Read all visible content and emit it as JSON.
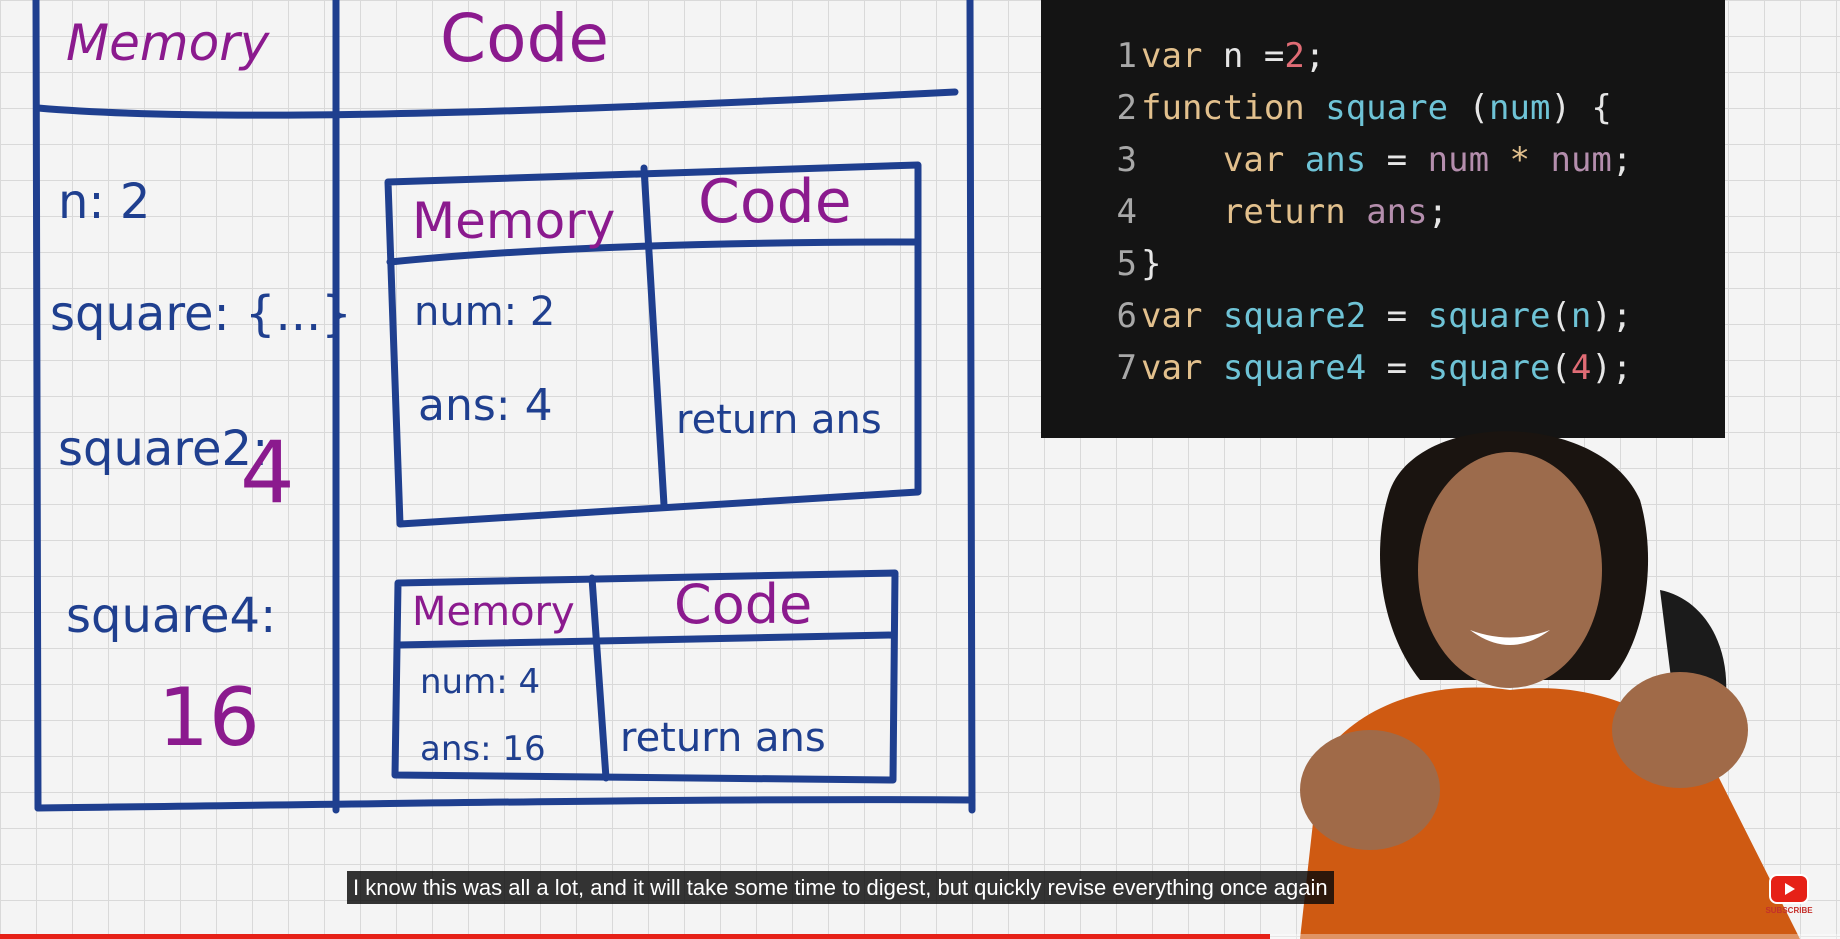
{
  "whiteboard": {
    "outer_headers": {
      "memory": "Memory",
      "code": "Code"
    },
    "global_memory": {
      "n": "n: 2",
      "square": "square: {...}",
      "square2_label": "square2:",
      "square2_value": "4",
      "square4_label": "square4:",
      "square4_value": "16"
    },
    "ctx1": {
      "memory_header": "Memory",
      "code_header": "Code",
      "num": "num: 2",
      "ans": "ans: 4",
      "code": "return ans"
    },
    "ctx2": {
      "memory_header": "Memory",
      "code_header": "Code",
      "num": "num: 4",
      "ans": "ans: 16",
      "code": "return ans"
    }
  },
  "code": {
    "lines": [
      {
        "n": "1",
        "tokens": [
          [
            "kw",
            "var "
          ],
          [
            "txt",
            "n ="
          ],
          [
            "num",
            "2"
          ],
          [
            "txt",
            ";"
          ]
        ]
      },
      {
        "n": "2",
        "tokens": [
          [
            "kw",
            "function "
          ],
          [
            "fn",
            "square "
          ],
          [
            "txt",
            "("
          ],
          [
            "fn",
            "num"
          ],
          [
            "txt",
            ") {"
          ]
        ]
      },
      {
        "n": "3",
        "tokens": [
          [
            "txt",
            "    "
          ],
          [
            "kw",
            "var "
          ],
          [
            "fn",
            "ans "
          ],
          [
            "txt",
            "= "
          ],
          [
            "var",
            "num "
          ],
          [
            "kw",
            "* "
          ],
          [
            "var",
            "num"
          ],
          [
            "txt",
            ";"
          ]
        ]
      },
      {
        "n": "4",
        "tokens": [
          [
            "txt",
            "    "
          ],
          [
            "kw",
            "return "
          ],
          [
            "var",
            "ans"
          ],
          [
            "txt",
            ";"
          ]
        ]
      },
      {
        "n": "5",
        "tokens": [
          [
            "txt",
            "}"
          ]
        ]
      },
      {
        "n": "6",
        "tokens": [
          [
            "kw",
            "var "
          ],
          [
            "fn",
            "square2 "
          ],
          [
            "txt",
            "= "
          ],
          [
            "fn",
            "square"
          ],
          [
            "txt",
            "("
          ],
          [
            "fn",
            "n"
          ],
          [
            "txt",
            ");"
          ]
        ]
      },
      {
        "n": "7",
        "tokens": [
          [
            "kw",
            "var "
          ],
          [
            "fn",
            "square4 "
          ],
          [
            "txt",
            "= "
          ],
          [
            "fn",
            "square"
          ],
          [
            "txt",
            "("
          ],
          [
            "num",
            "4"
          ],
          [
            "txt",
            ");"
          ]
        ]
      }
    ]
  },
  "player": {
    "caption": "I know this was all a lot, and it will take some time to digest, but quickly revise everything once again",
    "subscribe_label": "SUBSCRIBE",
    "progress": 0.69,
    "colors": {
      "progress": "#e62117",
      "ink_blue": "#1f3f8f",
      "ink_purple": "#8b1a8e"
    }
  }
}
